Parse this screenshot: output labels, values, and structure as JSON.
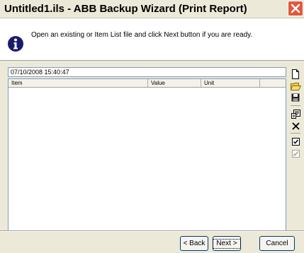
{
  "window": {
    "title": "Untitled1.ils - ABB Backup Wizard  (Print Report)"
  },
  "header": {
    "instruction": "Open an existing or Item List file and click Next button if you are ready."
  },
  "report": {
    "timestamp": "07/10/2008 15:40:47",
    "columns": [
      "Item",
      "Value",
      "Unit",
      ""
    ]
  },
  "toolbar": {
    "icons": [
      "new-file-icon",
      "open-folder-icon",
      "save-icon",
      "properties-icon",
      "delete-icon",
      "check-all-icon",
      "uncheck-all-icon"
    ]
  },
  "buttons": {
    "back": "< Back",
    "next": "Next >",
    "cancel": "Cancel"
  },
  "colors": {
    "title_close": "#e2583e",
    "info_icon": "#1a1a6e",
    "window_bg": "#ece9d8"
  }
}
